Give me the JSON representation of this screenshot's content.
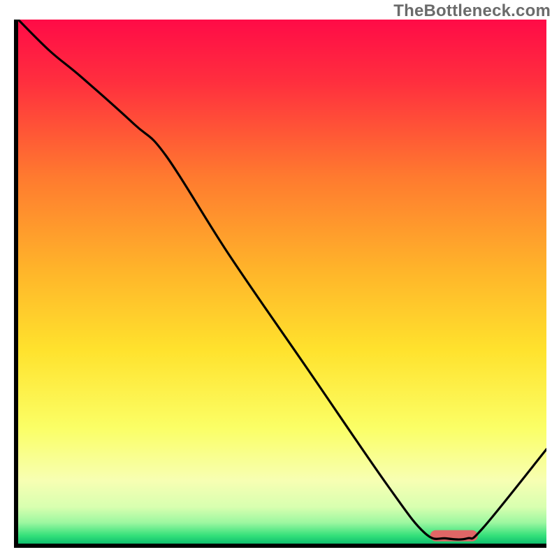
{
  "watermark": "TheBottleneck.com",
  "chart_data": {
    "type": "line",
    "title": "",
    "xlabel": "",
    "ylabel": "",
    "xlim": [
      0,
      100
    ],
    "ylim": [
      0,
      100
    ],
    "grid": false,
    "legend": false,
    "series": [
      {
        "name": "curve",
        "x": [
          0,
          6,
          12,
          22,
          28,
          40,
          55,
          70,
          77,
          81,
          85,
          88,
          100
        ],
        "y": [
          100,
          94,
          89,
          80,
          74,
          55,
          33,
          11,
          2,
          1,
          1,
          3,
          18
        ]
      }
    ],
    "marker": {
      "x_start": 78,
      "x_end": 87,
      "y": 1.5,
      "color": "#e06666"
    },
    "gradient_stops": [
      {
        "offset": 0,
        "color": "#ff0b47"
      },
      {
        "offset": 12,
        "color": "#ff2f3e"
      },
      {
        "offset": 30,
        "color": "#ff7a2f"
      },
      {
        "offset": 48,
        "color": "#ffb52a"
      },
      {
        "offset": 63,
        "color": "#ffe22d"
      },
      {
        "offset": 78,
        "color": "#fbff66"
      },
      {
        "offset": 88,
        "color": "#f7ffb3"
      },
      {
        "offset": 93,
        "color": "#d8ffb0"
      },
      {
        "offset": 96,
        "color": "#9cf7a0"
      },
      {
        "offset": 98.5,
        "color": "#33e07a"
      },
      {
        "offset": 100,
        "color": "#0fbf6e"
      }
    ]
  }
}
